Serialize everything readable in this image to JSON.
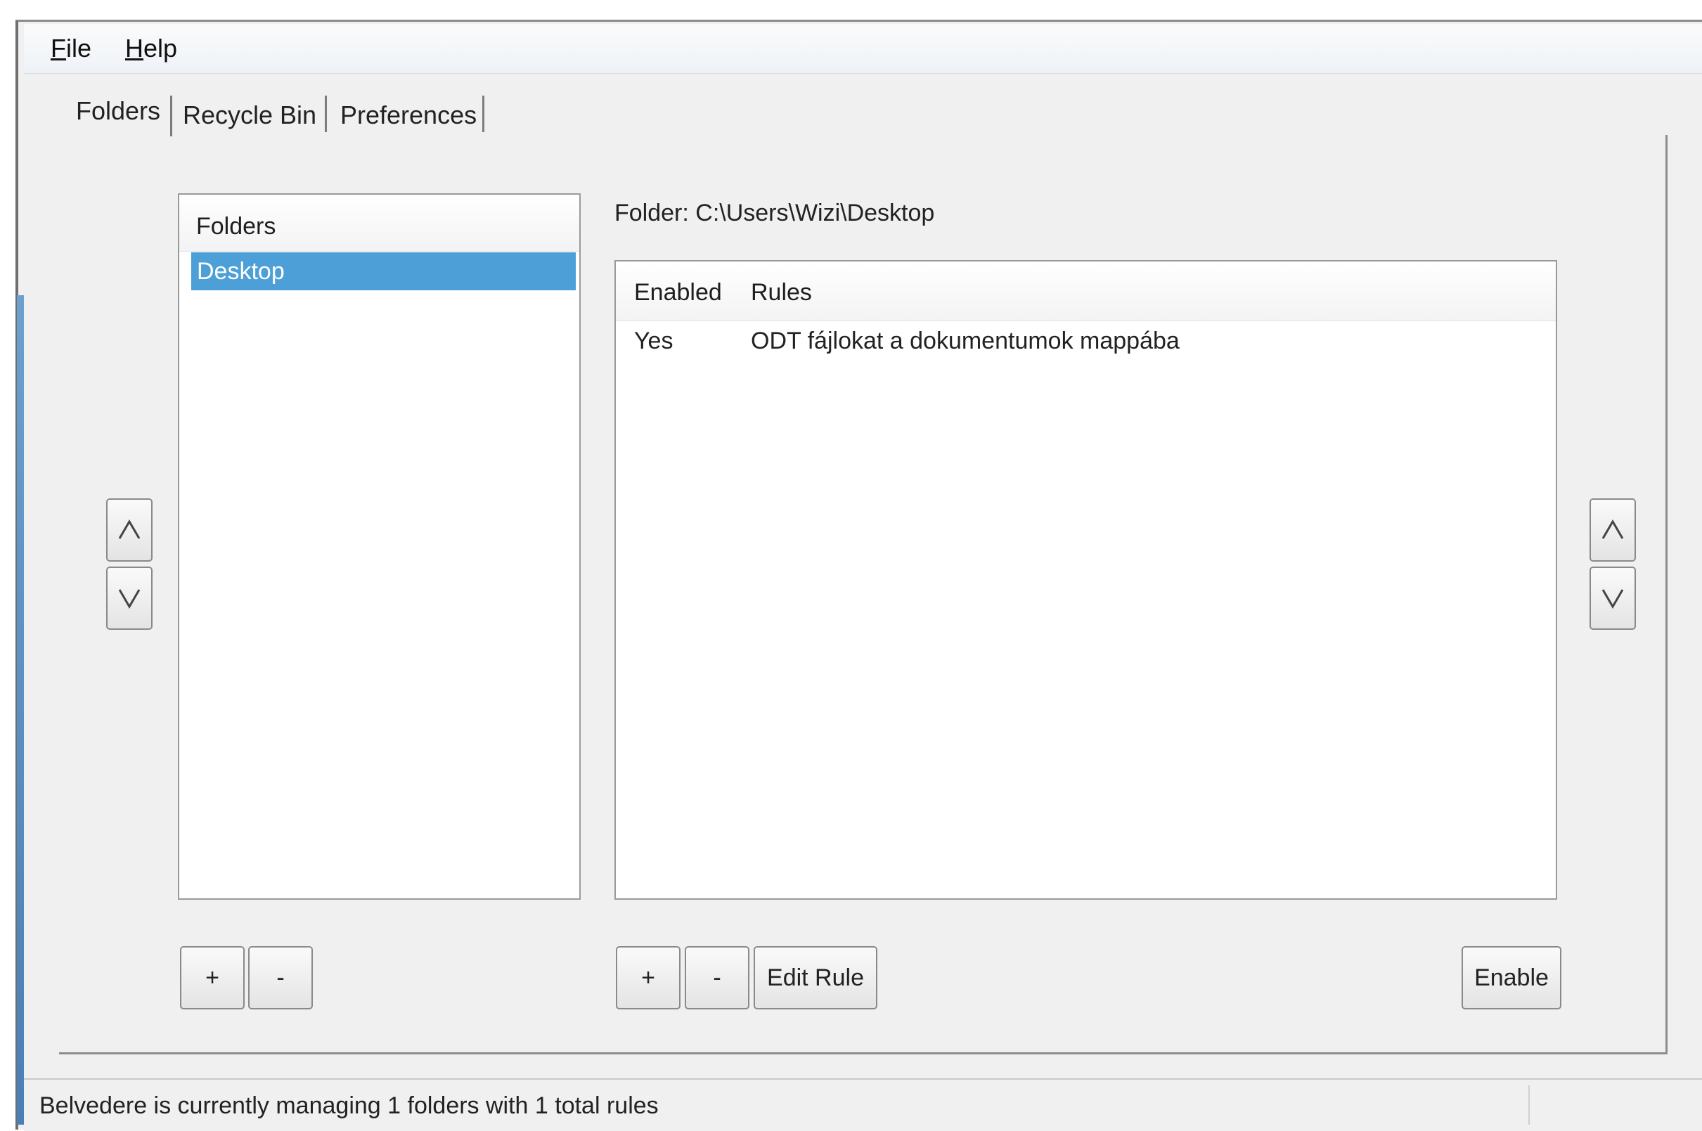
{
  "menu": {
    "file": {
      "accel": "F",
      "rest": "ile"
    },
    "help": {
      "accel": "H",
      "rest": "elp"
    }
  },
  "tabs": [
    {
      "label": "Folders",
      "selected": true
    },
    {
      "label": "Recycle Bin",
      "selected": false
    },
    {
      "label": "Preferences",
      "selected": false
    }
  ],
  "folders_list": {
    "header": "Folders",
    "items": [
      {
        "label": "Desktop",
        "selected": true
      }
    ]
  },
  "folder_path": "Folder:  C:\\Users\\Wizi\\Desktop",
  "rules_table": {
    "columns": [
      "Enabled",
      "Rules"
    ],
    "rows": [
      {
        "enabled": "Yes",
        "rule": "ODT fájlokat a dokumentumok mappába"
      }
    ]
  },
  "buttons": {
    "folder_add": "+",
    "folder_remove": "-",
    "rule_add": "+",
    "rule_remove": "-",
    "edit_rule": "Edit Rule",
    "enable": "Enable"
  },
  "icons": {
    "move_up": "chevron-up-icon",
    "move_down": "chevron-down-icon"
  },
  "status": {
    "text": "Belvedere is currently managing 1 folders with 1 total rules"
  }
}
